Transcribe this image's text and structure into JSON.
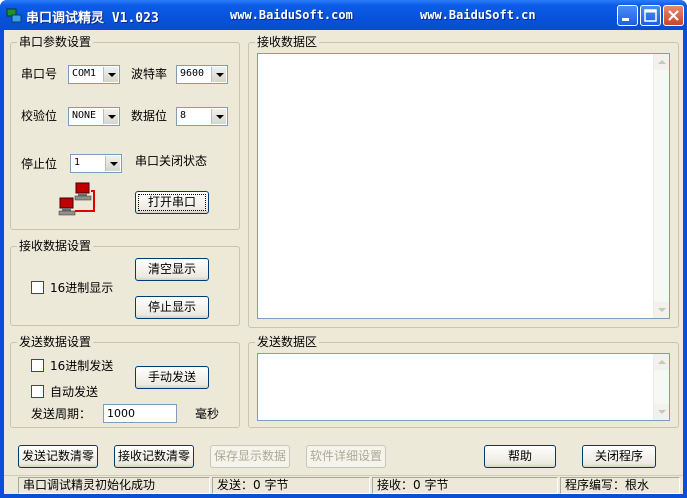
{
  "titlebar": {
    "title": "串口调试精灵 V1.023",
    "url1": "www.BaiduSoft.com",
    "url2": "www.BaiduSoft.cn"
  },
  "serial_params": {
    "group_title": "串口参数设置",
    "port_label": "串口号",
    "port_value": "COM1",
    "baud_label": "波特率",
    "baud_value": "9600",
    "parity_label": "校验位",
    "parity_value": "NONE",
    "databits_label": "数据位",
    "databits_value": "8",
    "stopbits_label": "停止位",
    "stopbits_value": "1",
    "port_status": "串口关闭状态",
    "open_button": "打开串口"
  },
  "receive_settings": {
    "group_title": "接收数据设置",
    "hex_display_label": "16进制显示",
    "clear_button": "清空显示",
    "stop_button": "停止显示"
  },
  "send_settings": {
    "group_title": "发送数据设置",
    "hex_send_label": "16进制发送",
    "auto_send_label": "自动发送",
    "manual_send_button": "手动发送",
    "period_label": "发送周期：",
    "period_value": "1000",
    "period_unit": "毫秒"
  },
  "receive_area": {
    "group_title": "接收数据区"
  },
  "send_area": {
    "group_title": "发送数据区"
  },
  "bottom_buttons": {
    "clear_send_count": "发送记数清零",
    "clear_recv_count": "接收记数清零",
    "save_display": "保存显示数据",
    "software_settings": "软件详细设置",
    "help": "帮助",
    "close_program": "关闭程序"
  },
  "statusbar": {
    "message": "串口调试精灵初始化成功",
    "sent": "发送：0 字节",
    "received": "接收：0 字节",
    "author": "程序编写：根水"
  },
  "colors": {
    "titlebar": "#0a4fd6",
    "client": "#ece9d8",
    "button_border": "#003c74"
  }
}
